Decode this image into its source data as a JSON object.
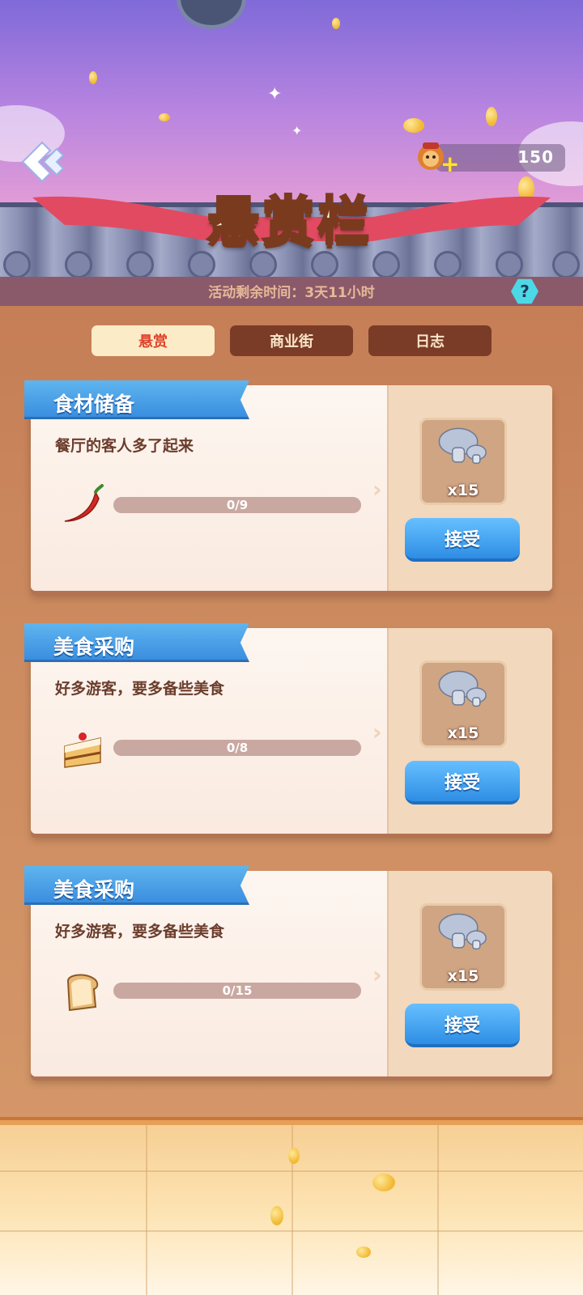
{
  "header": {
    "title": "悬赏栏",
    "currency_value": "150",
    "timer_text": "活动剩余时间：3天11小时"
  },
  "tabs": [
    {
      "label": "悬赏",
      "active": true
    },
    {
      "label": "商业街",
      "active": false
    },
    {
      "label": "日志",
      "active": false
    }
  ],
  "quests": [
    {
      "tag": "食材储备",
      "description": "餐厅的客人多了起来",
      "item_icon": "chili-pepper-icon",
      "progress_text": "0/9",
      "progress_fraction": 0,
      "reward_icon": "mushroom-icon",
      "reward_count": "x15",
      "button_label": "接受"
    },
    {
      "tag": "美食采购",
      "description": "好多游客，要多备些美食",
      "item_icon": "cake-slice-icon",
      "progress_text": "0/8",
      "progress_fraction": 0,
      "reward_icon": "mushroom-icon",
      "reward_count": "x15",
      "button_label": "接受"
    },
    {
      "tag": "美食采购",
      "description": "好多游客，要多备些美食",
      "item_icon": "bread-slice-icon",
      "progress_text": "0/15",
      "progress_fraction": 0,
      "reward_icon": "mushroom-icon",
      "reward_count": "x15",
      "button_label": "接受"
    }
  ],
  "colors": {
    "accent_blue": "#3a8ee0",
    "active_tab_text": "#e0432c",
    "inactive_tab_bg": "#7a3c26",
    "progress_track": "#c9a8a1"
  }
}
